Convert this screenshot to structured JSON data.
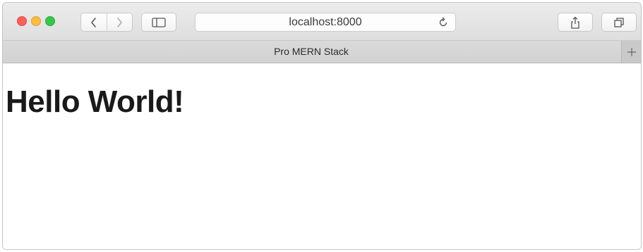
{
  "browser": {
    "address": "localhost:8000",
    "tab_title": "Pro MERN Stack",
    "colors": {
      "close": "#fc605b",
      "minimize": "#fdbc40",
      "maximize": "#34c84a"
    },
    "icons": [
      "back-icon",
      "forward-icon",
      "sidebar-icon",
      "reload-icon",
      "share-icon",
      "tabs-overview-icon",
      "plus-icon"
    ]
  },
  "page": {
    "heading": "Hello World!"
  }
}
